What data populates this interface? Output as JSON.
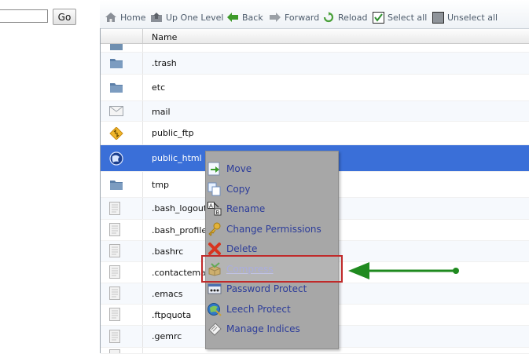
{
  "search": {
    "value": "",
    "go_label": "Go"
  },
  "toolbar": {
    "home": "Home",
    "up": "Up One Level",
    "back": "Back",
    "forward": "Forward",
    "reload": "Reload",
    "select_all": "Select all",
    "unselect_all": "Unselect all"
  },
  "table": {
    "name_header": "Name"
  },
  "files": [
    {
      "name": ".trash",
      "type": "folder"
    },
    {
      "name": "etc",
      "type": "folder"
    },
    {
      "name": "mail",
      "type": "mail"
    },
    {
      "name": "public_ftp",
      "type": "ftp"
    },
    {
      "name": "public_html",
      "type": "web",
      "selected": true
    },
    {
      "name": "tmp",
      "type": "folder"
    },
    {
      "name": ".bash_logout",
      "type": "file"
    },
    {
      "name": ".bash_profile",
      "type": "file"
    },
    {
      "name": ".bashrc",
      "type": "file"
    },
    {
      "name": ".contactemail",
      "type": "file"
    },
    {
      "name": ".emacs",
      "type": "file"
    },
    {
      "name": ".ftpquota",
      "type": "file"
    },
    {
      "name": ".gemrc",
      "type": "file"
    }
  ],
  "context_menu": {
    "items": [
      {
        "label": "Move",
        "icon": "move-icon"
      },
      {
        "label": "Copy",
        "icon": "copy-icon"
      },
      {
        "label": "Rename",
        "icon": "rename-icon"
      },
      {
        "label": "Change Permissions",
        "icon": "key-icon"
      },
      {
        "label": "Delete",
        "icon": "delete-icon"
      },
      {
        "label": "Compress",
        "icon": "compress-icon",
        "state": "disabled"
      },
      {
        "label": "Password Protect",
        "icon": "password-icon"
      },
      {
        "label": "Leech Protect",
        "icon": "leech-icon"
      },
      {
        "label": "Manage Indices",
        "icon": "indices-icon"
      }
    ]
  },
  "colors": {
    "selected_row": "#3a6fd8",
    "menu_bg": "#a7a7a7",
    "menu_text": "#2c3c9a",
    "highlight_border": "#c02a2a",
    "arrow": "#1f8a1f"
  }
}
